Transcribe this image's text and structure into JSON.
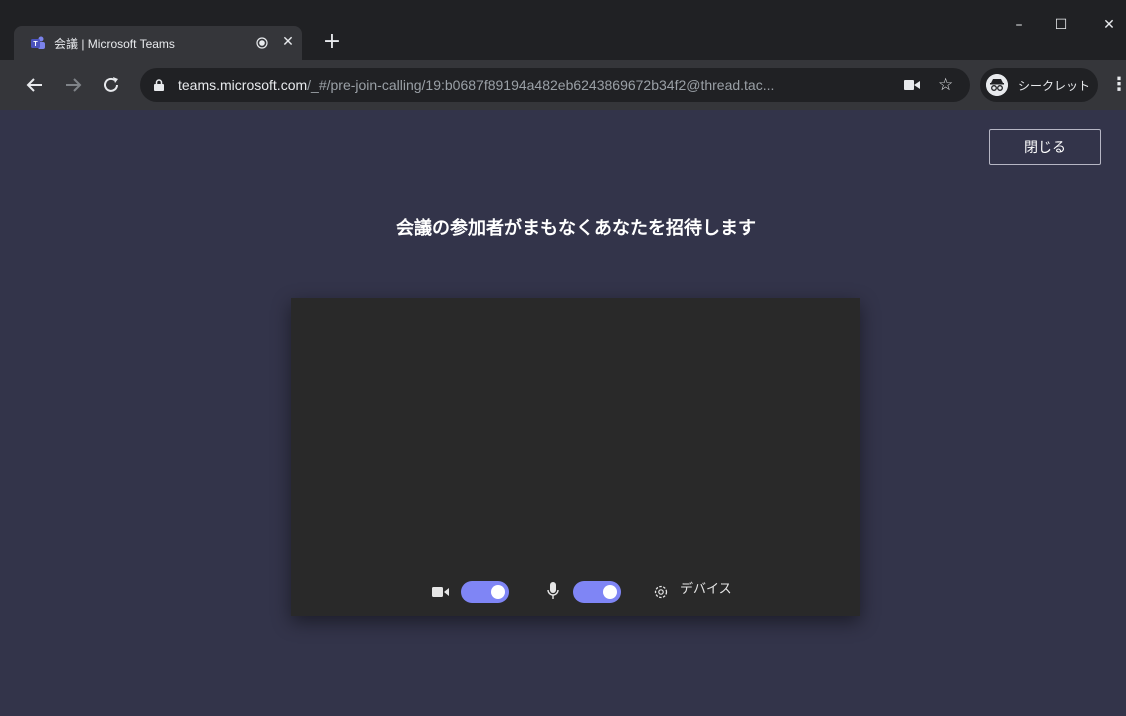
{
  "browser": {
    "tab_title": "会議 | Microsoft Teams",
    "new_tab_symbol": "+",
    "url_host": "teams.microsoft.com",
    "url_path": "/_#/pre-join-calling/19:b0687f89194a482eb6243869672b34f2@thread.tac...",
    "incognito_label": "シークレット",
    "window_controls": {
      "minimize": "–",
      "maximize": "☐",
      "close": "✕"
    }
  },
  "page": {
    "close_label": "閉じる",
    "heading": "会議の参加者がまもなくあなたを招待します",
    "controls": {
      "camera_on": true,
      "mic_on": true,
      "devices_label": "デバイス"
    }
  },
  "colors": {
    "page_bg": "#33344a",
    "video_bg": "#292929",
    "toggle_accent": "#7f85f5"
  }
}
